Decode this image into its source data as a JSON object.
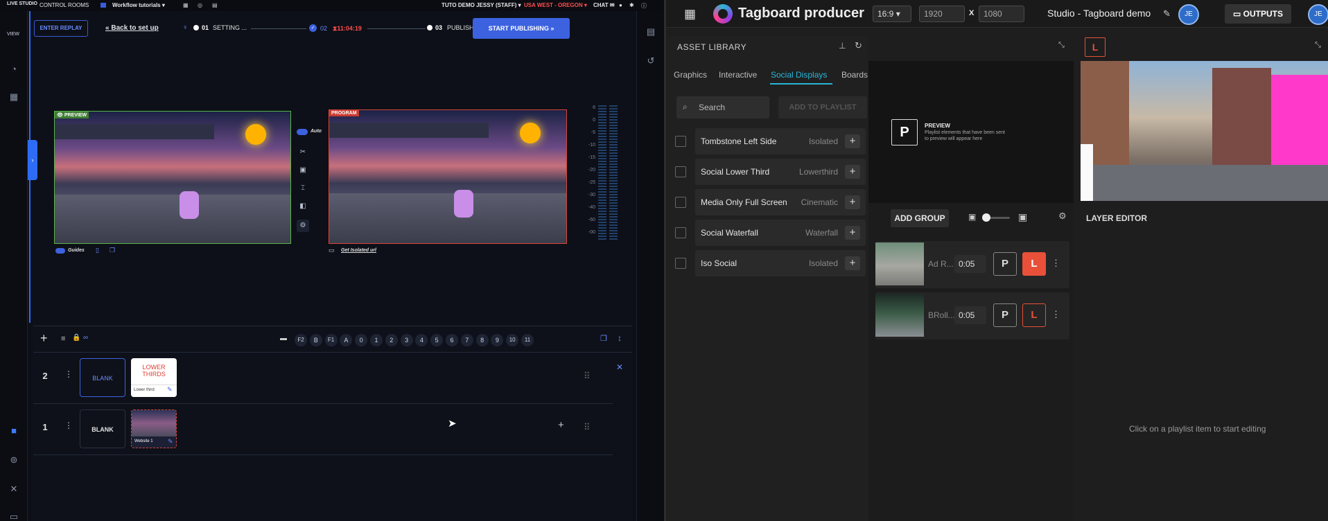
{
  "left_app": {
    "topbar": {
      "logo": "LIVE STUDIO",
      "control_rooms": "CONTROL ROOMS",
      "workflow": "Workflow tutorials",
      "user": "TUTO DEMO JESSY (STAFF)",
      "region": "USA WEST - OREGON",
      "chat": "CHAT"
    },
    "rail": {
      "view_label": "VIEW"
    },
    "steps": {
      "enter_replay": "ENTER REPLAY",
      "back_to_setup": "Back to set up",
      "step1_num": "01",
      "step1_label": "SETTING ...",
      "step2_num": "02",
      "step2_time": "11:04:19",
      "step3_num": "03",
      "step3_label": "PUBLISH",
      "start_publishing": "START PUBLISHING"
    },
    "monitors": {
      "preview_tag": "PREVIEW",
      "program_tag": "PROGRAM",
      "auto_label": "Auto",
      "guides_label": "Guides",
      "isolated_link": "Get Isolated url"
    },
    "meter_labels": [
      "6",
      "0",
      "-5",
      "-10",
      "-15",
      "-20",
      "-25",
      "-30",
      "-40",
      "-60",
      "-00"
    ],
    "toolbar": {
      "buttons": [
        "F2",
        "B",
        "F1",
        "A",
        "0",
        "1",
        "2",
        "3",
        "4",
        "5",
        "6",
        "7",
        "8",
        "9",
        "10",
        "11"
      ]
    },
    "rows": [
      {
        "num": "2",
        "blank": "BLANK",
        "card_title": "LOWER THIRDS",
        "card_label": "Lower third"
      },
      {
        "num": "1",
        "blank": "BLANK",
        "card_label": "Website 1"
      }
    ]
  },
  "right_app": {
    "brand": "Tagboard producer",
    "aspect": "16:9",
    "width": "1920",
    "height": "1080",
    "x_sep": "X",
    "studio": "Studio - Tagboard demo",
    "avatar": "JE",
    "outputs": "OUTPUTS",
    "live_badge": "L",
    "asset_library": {
      "title": "ASSET LIBRARY",
      "tabs": [
        "Graphics",
        "Interactive",
        "Social Displays",
        "Boards"
      ],
      "active_tab": "Social Displays",
      "search_placeholder": "Search",
      "add_to_playlist": "ADD TO PLAYLIST",
      "items": [
        {
          "name": "Tombstone Left Side",
          "type": "Isolated"
        },
        {
          "name": "Social Lower Third",
          "type": "Lowerthird"
        },
        {
          "name": "Media Only Full Screen",
          "type": "Cinematic"
        },
        {
          "name": "Social Waterfall",
          "type": "Waterfall"
        },
        {
          "name": "Iso Social",
          "type": "Isolated"
        }
      ]
    },
    "preview": {
      "badge": "P",
      "title": "PREVIEW",
      "desc_line1": "Playlist elements that have been sent",
      "desc_line2": "to preview will appear here"
    },
    "playlist": {
      "add_group": "ADD GROUP",
      "items": [
        {
          "name": "Ad R...",
          "duration": "0:05",
          "p": "P",
          "l": "L"
        },
        {
          "name": "BRoll...",
          "duration": "0:05",
          "p": "P",
          "l": "L"
        }
      ]
    },
    "layer_editor": {
      "title": "LAYER EDITOR",
      "empty_text": "Click on a playlist item to start editing"
    }
  },
  "colors": {
    "accent_blue": "#3c62e0",
    "teal": "#29b6d8",
    "live_red": "#e8503a",
    "region_red": "#ff4d4d"
  }
}
